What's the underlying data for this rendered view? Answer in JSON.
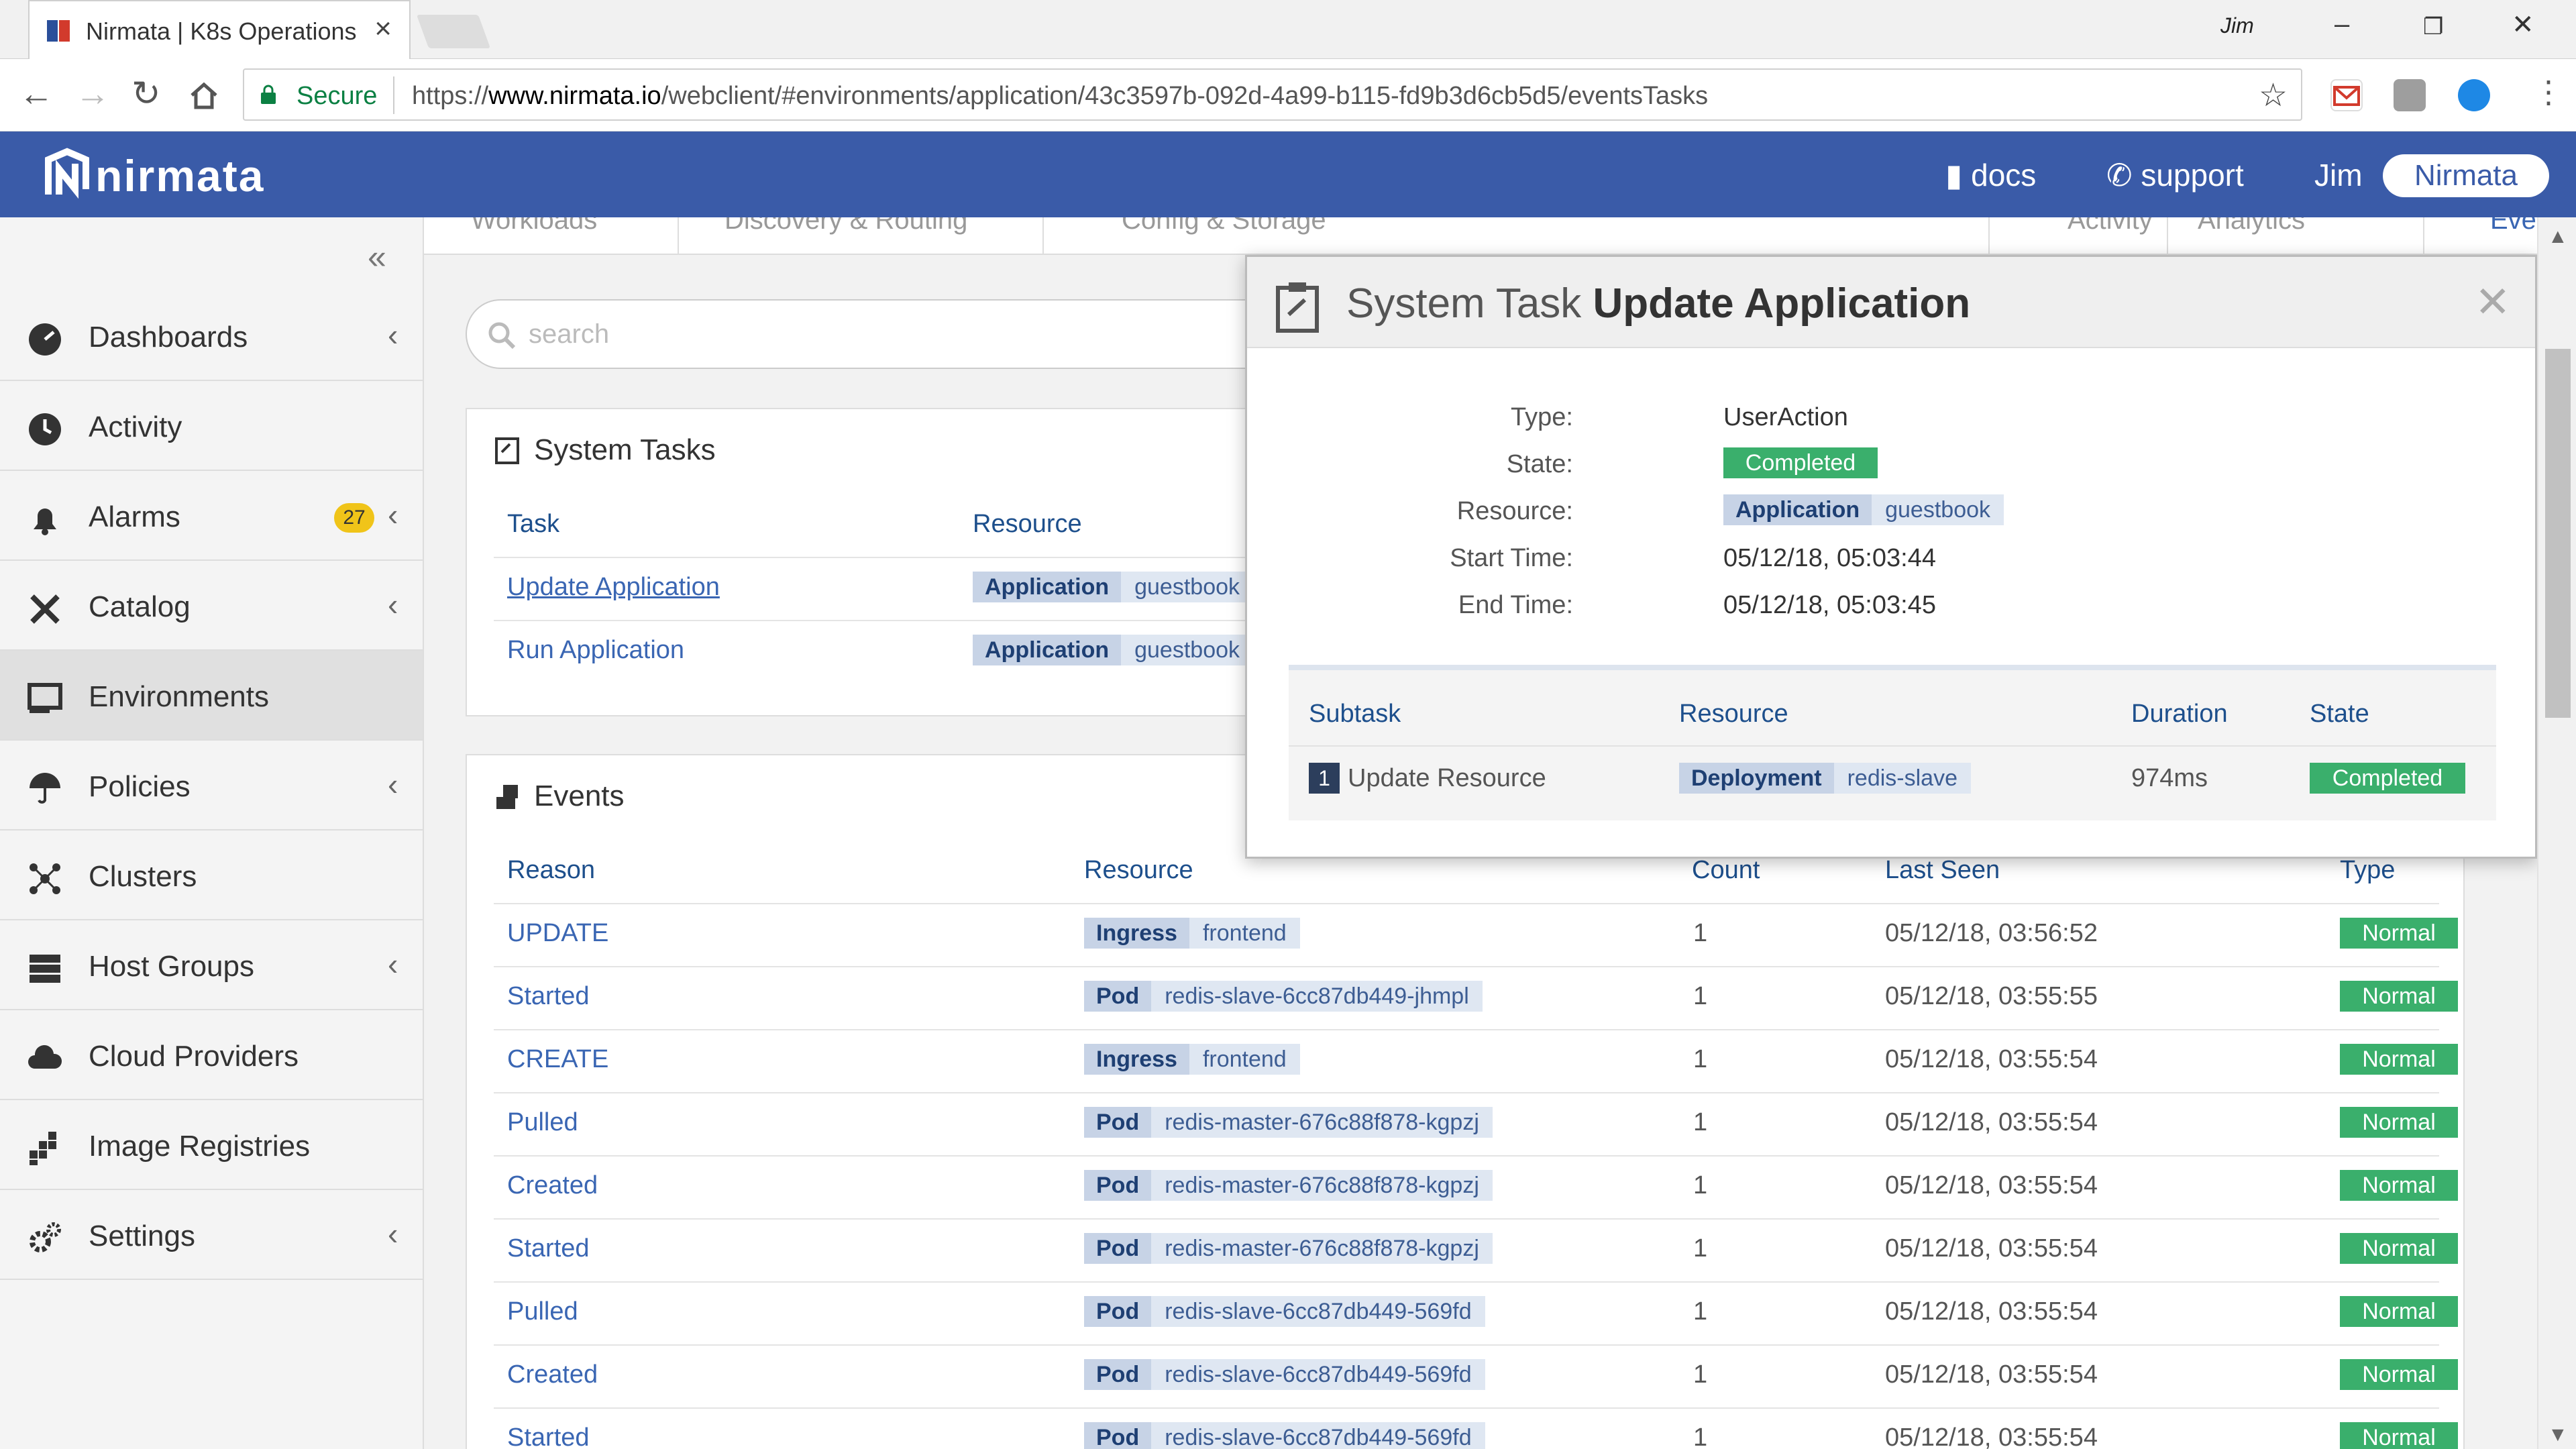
{
  "browser": {
    "tab_title": "Nirmata | K8s Operations",
    "tab_close": "×",
    "window_user": "Jim",
    "secure_label": "Secure",
    "url_scheme": "https://",
    "url_host": "www.nirmata.io",
    "url_path": "/webclient/#environments/application/43c3597b-092d-4a99-b115-fd9b3d6cb5d5/eventsTasks"
  },
  "header": {
    "logo_text": "nirmata",
    "docs_label": "docs",
    "support_label": "support",
    "user_label": "Jim",
    "org_label": "Nirmata"
  },
  "sidebar": {
    "collapse_glyph": "«",
    "items": [
      {
        "label": "Dashboards",
        "icon": "dashboard-icon"
      },
      {
        "label": "Activity",
        "icon": "activity-icon"
      },
      {
        "label": "Alarms",
        "icon": "bell-icon",
        "badge": "27"
      },
      {
        "label": "Catalog",
        "icon": "catalog-icon"
      },
      {
        "label": "Environments",
        "icon": "environments-icon"
      },
      {
        "label": "Policies",
        "icon": "umbrella-icon"
      },
      {
        "label": "Clusters",
        "icon": "clusters-icon"
      },
      {
        "label": "Host Groups",
        "icon": "server-icon"
      },
      {
        "label": "Cloud Providers",
        "icon": "cloud-icon"
      },
      {
        "label": "Image Registries",
        "icon": "registry-icon"
      },
      {
        "label": "Settings",
        "icon": "gear-icon"
      }
    ]
  },
  "subnav": {
    "tabs": [
      "Workloads",
      "Discovery & Routing",
      "Config & Storage",
      "Activity",
      "Analytics",
      "Events & Tasks"
    ]
  },
  "search": {
    "placeholder": "search"
  },
  "system_tasks": {
    "title": "System Tasks",
    "columns": {
      "task": "Task",
      "resource": "Resource"
    },
    "rows": [
      {
        "task": "Update Application",
        "kind": "Application",
        "name": "guestbook"
      },
      {
        "task": "Run Application",
        "kind": "Application",
        "name": "guestbook"
      }
    ]
  },
  "events": {
    "title": "Events",
    "columns": {
      "reason": "Reason",
      "resource": "Resource",
      "count": "Count",
      "last_seen": "Last Seen",
      "type": "Type"
    },
    "rows": [
      {
        "reason": "UPDATE",
        "kind": "Ingress",
        "name": "frontend",
        "count": "1",
        "last_seen": "05/12/18, 03:56:52",
        "type": "Normal"
      },
      {
        "reason": "Started",
        "kind": "Pod",
        "name": "redis-slave-6cc87db449-jhmpl",
        "count": "1",
        "last_seen": "05/12/18, 03:55:55",
        "type": "Normal"
      },
      {
        "reason": "CREATE",
        "kind": "Ingress",
        "name": "frontend",
        "count": "1",
        "last_seen": "05/12/18, 03:55:54",
        "type": "Normal"
      },
      {
        "reason": "Pulled",
        "kind": "Pod",
        "name": "redis-master-676c88f878-kgpzj",
        "count": "1",
        "last_seen": "05/12/18, 03:55:54",
        "type": "Normal"
      },
      {
        "reason": "Created",
        "kind": "Pod",
        "name": "redis-master-676c88f878-kgpzj",
        "count": "1",
        "last_seen": "05/12/18, 03:55:54",
        "type": "Normal"
      },
      {
        "reason": "Started",
        "kind": "Pod",
        "name": "redis-master-676c88f878-kgpzj",
        "count": "1",
        "last_seen": "05/12/18, 03:55:54",
        "type": "Normal"
      },
      {
        "reason": "Pulled",
        "kind": "Pod",
        "name": "redis-slave-6cc87db449-569fd",
        "count": "1",
        "last_seen": "05/12/18, 03:55:54",
        "type": "Normal"
      },
      {
        "reason": "Created",
        "kind": "Pod",
        "name": "redis-slave-6cc87db449-569fd",
        "count": "1",
        "last_seen": "05/12/18, 03:55:54",
        "type": "Normal"
      },
      {
        "reason": "Started",
        "kind": "Pod",
        "name": "redis-slave-6cc87db449-569fd",
        "count": "1",
        "last_seen": "05/12/18, 03:55:54",
        "type": "Normal"
      }
    ]
  },
  "modal": {
    "title_prefix": "System Task",
    "title_name": "Update Application",
    "close_glyph": "✕",
    "labels": {
      "type": "Type:",
      "state": "State:",
      "resource": "Resource:",
      "start": "Start Time:",
      "end": "End Time:"
    },
    "type": "UserAction",
    "state": "Completed",
    "resource_kind": "Application",
    "resource_name": "guestbook",
    "start_time": "05/12/18, 05:03:44",
    "end_time": "05/12/18, 05:03:45",
    "subtask_columns": {
      "subtask": "Subtask",
      "resource": "Resource",
      "duration": "Duration",
      "state": "State"
    },
    "subtasks": [
      {
        "num": "1",
        "name": "Update Resource",
        "kind": "Deployment",
        "res_name": "redis-slave",
        "duration": "974ms",
        "state": "Completed"
      }
    ]
  },
  "colors": {
    "header_bg": "#3a5ba8",
    "link": "#3a66b3",
    "badge_green": "#3aaf6c",
    "alarm_badge": "#f0c419"
  }
}
